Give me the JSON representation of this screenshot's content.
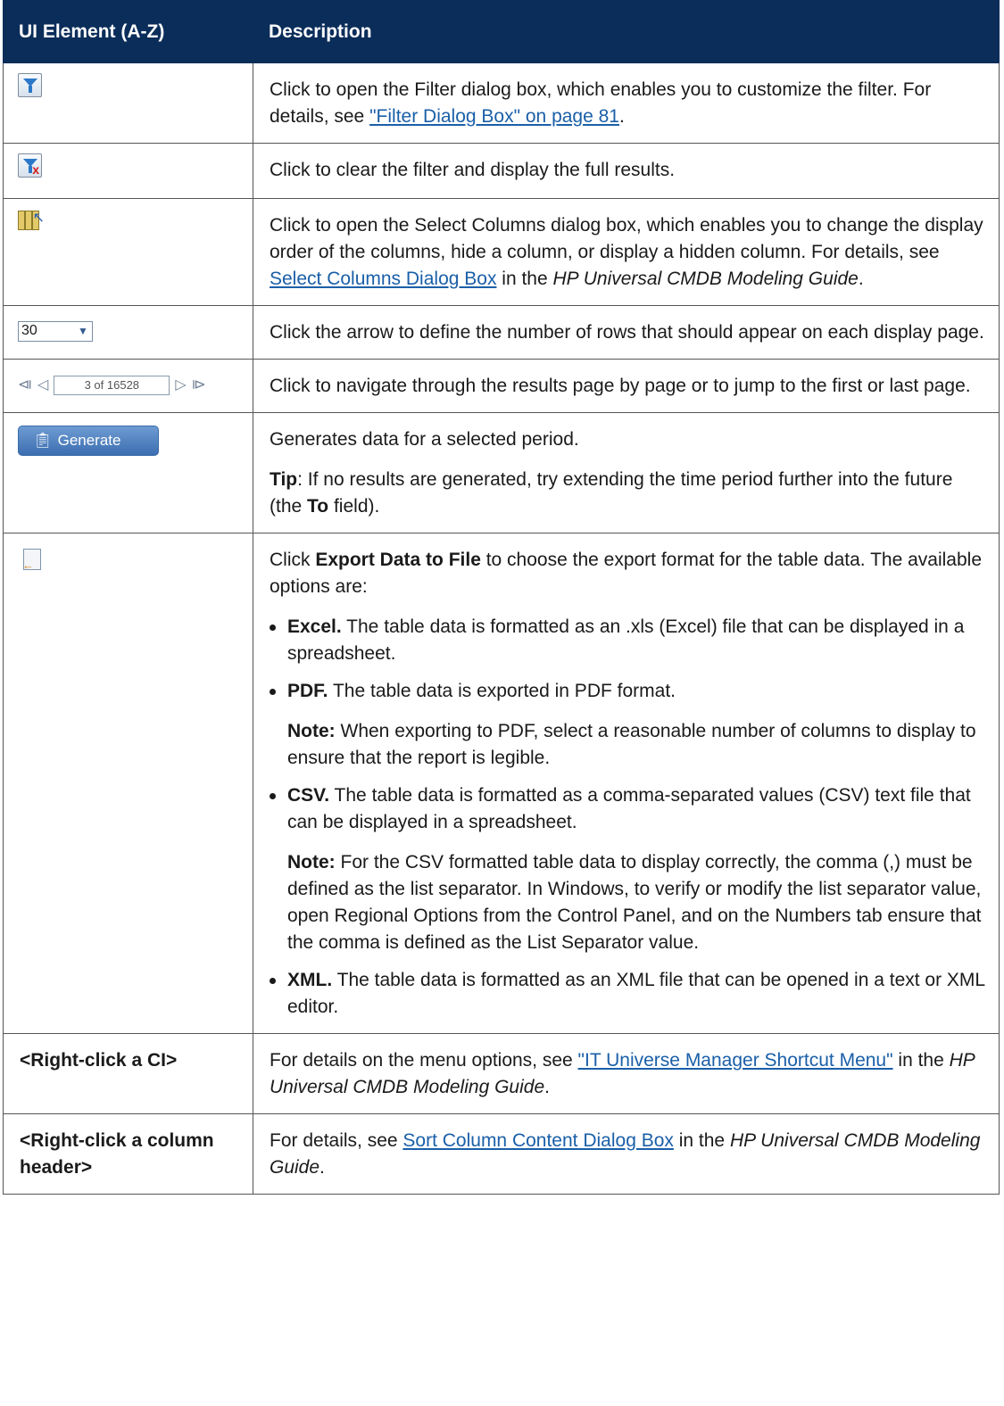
{
  "header": {
    "col1": "UI Element (A-Z)",
    "col2": "Description"
  },
  "rows": {
    "filter": {
      "icon": "filter-icon",
      "text_pre": "Click to open the Filter dialog box, which enables you to customize the filter. For details, see ",
      "link": "\"Filter Dialog Box\" on page 81",
      "text_post": "."
    },
    "clear_filter": {
      "icon": "clear-filter-icon",
      "text": "Click to clear the filter and display the full results."
    },
    "select_columns": {
      "icon": "select-columns-icon",
      "text_pre": "Click to open the Select Columns dialog box, which enables you to change the display order of the columns, hide a column, or display a hidden column. For details, see ",
      "link": "Select Columns Dialog Box",
      "text_mid": " in the ",
      "guide": "HP Universal CMDB Modeling Guide",
      "text_post": "."
    },
    "rows_per_page": {
      "value": "30",
      "text": "Click the arrow to define the number of rows that should appear on each display page."
    },
    "pager": {
      "box": "3 of 16528",
      "text": "Click to navigate through the results page by page or to jump to the first or last page."
    },
    "generate": {
      "button": "Generate",
      "text": "Generates data for a selected period.",
      "tip_label": "Tip",
      "tip_pre": ": If no results are generated, try extending the time period further into the future (the ",
      "tip_bold": "To",
      "tip_post": " field)."
    },
    "export": {
      "icon": "export-icon",
      "intro_pre": "Click ",
      "intro_bold": "Export Data to File",
      "intro_post": " to choose the export format for the table data. The available options are:",
      "excel_label": "Excel.",
      "excel_text": " The table data is formatted as an .xls (Excel) file that can be displayed in a spreadsheet.",
      "pdf_label": "PDF.",
      "pdf_text": " The table data is exported in PDF format.",
      "pdf_note_label": "Note:",
      "pdf_note_text": " When exporting to PDF, select a reasonable number of columns to display to ensure that the report is legible.",
      "csv_label": "CSV.",
      "csv_text": " The table data is formatted as a comma-separated values (CSV) text file that can be displayed in a spreadsheet.",
      "csv_note_label": "Note:",
      "csv_note_text": " For the CSV formatted table data to display correctly, the comma (,) must be defined as the list separator. In Windows, to verify or modify the list separator value, open Regional Options from the Control Panel, and on the Numbers tab ensure that the comma is defined as the List Separator value.",
      "xml_label": "XML.",
      "xml_text": " The table data is formatted as an XML file that can be opened in a text or XML editor."
    },
    "right_click_ci": {
      "element": "<Right-click a CI>",
      "text_pre": "For details on the menu options, see ",
      "link": "\"IT Universe Manager Shortcut Menu\"",
      "text_mid": " in the ",
      "guide": "HP Universal CMDB Modeling Guide",
      "text_post": "."
    },
    "right_click_header": {
      "element": "<Right-click a column header>",
      "text_pre": "For details, see ",
      "link": "Sort Column Content Dialog Box",
      "text_mid": " in the ",
      "guide": "HP Universal CMDB Modeling Guide",
      "text_post": "."
    }
  }
}
